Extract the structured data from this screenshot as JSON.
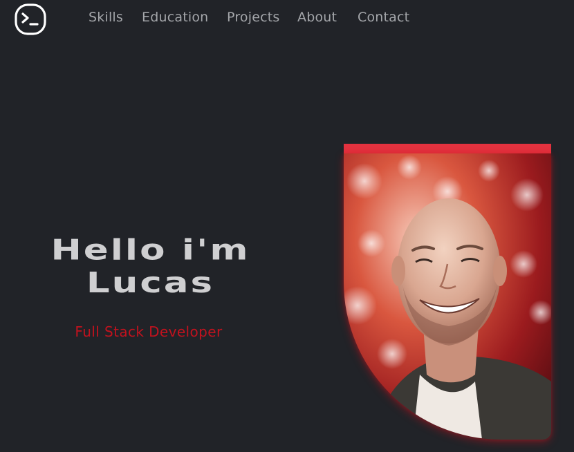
{
  "header": {
    "logo_icon": "terminal-prompt-icon",
    "nav_items": [
      "Skills",
      "Education",
      "Projects",
      "About",
      "Contact"
    ]
  },
  "hero": {
    "title_line1": "Hello i'm",
    "title_line2": "Lucas",
    "subtitle": "Full Stack Developer",
    "photo_icon": "profile-photo"
  },
  "colors": {
    "background": "#212328",
    "nav_text": "#a4a6aa",
    "title_text": "#cfcfd1",
    "accent_red": "#c2121e",
    "photo_bar": "#e3323f"
  }
}
